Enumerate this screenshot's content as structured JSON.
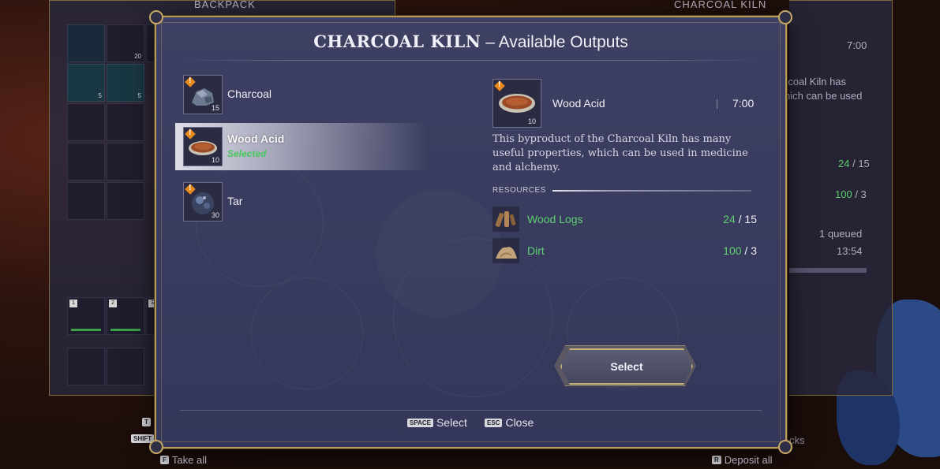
{
  "background": {
    "backpack_title": "BACKPACK",
    "kiln_title": "CHARCOAL KILN",
    "backpack_slots_counts": [
      "",
      "20",
      "",
      "5",
      "5"
    ],
    "hotbar_numbers": [
      "1",
      "2",
      "3"
    ],
    "right_panel": {
      "time": "7:00",
      "desc_line1": "rcoal Kiln has",
      "desc_line2": "hich can be used",
      "res1_have": "24",
      "res1_need": "/ 15",
      "res2_have": "100",
      "res2_need": "/ 3",
      "queued": "1 queued",
      "queued_time": "13:54",
      "cut_text": "cks"
    },
    "side_keys": [
      "T",
      "SHIFT"
    ],
    "take_all": {
      "key": "F",
      "label": "Take all"
    },
    "deposit_all": {
      "key": "R",
      "label": "Deposit all"
    }
  },
  "dialog": {
    "title_strong": "CHARCOAL KILN",
    "title_rest": " – Available Outputs",
    "outputs": [
      {
        "name": "Charcoal",
        "count": "15",
        "status": ""
      },
      {
        "name": "Wood Acid",
        "count": "10",
        "status": "Selected"
      },
      {
        "name": "Tar",
        "count": "30",
        "status": ""
      }
    ],
    "detail": {
      "name": "Wood Acid",
      "time": "7:00",
      "count": "10",
      "description": "This byproduct of the Charcoal Kiln has many useful properties, which can be used in medicine and alchemy.",
      "resources_heading": "RESOURCES",
      "resources": [
        {
          "name": "Wood Logs",
          "have": "24",
          "need": "/ 15"
        },
        {
          "name": "Dirt",
          "have": "100",
          "need": "/ 3"
        }
      ]
    },
    "select_button": "Select",
    "footer": [
      {
        "key": "SPACE",
        "label": "Select"
      },
      {
        "key": "ESC",
        "label": "Close"
      }
    ]
  },
  "colors": {
    "accent_gold": "#b79a5a",
    "resource_green": "#5fd073",
    "selected_green": "#46c85a",
    "badge_orange": "#e98a1e"
  }
}
